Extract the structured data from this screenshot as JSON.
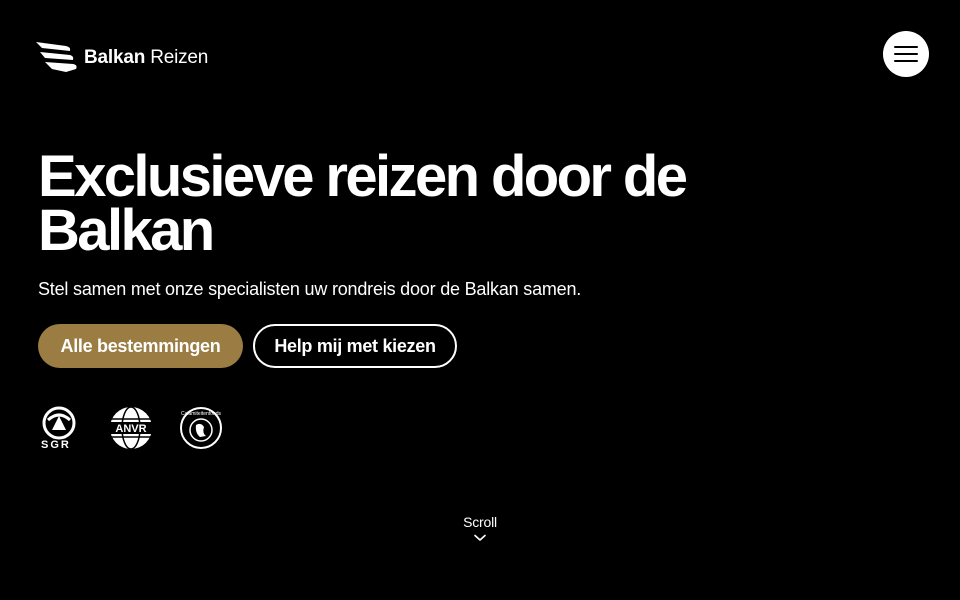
{
  "header": {
    "brand_bold": "Balkan",
    "brand_light": "Reizen",
    "menu_icon": "hamburger-menu-icon"
  },
  "hero": {
    "title": "Exclusieve reizen door de Balkan",
    "subtitle": "Stel samen met onze specialisten uw rondreis door de Balkan samen.",
    "primary_button": "Alle bestemmingen",
    "secondary_button": "Help mij met kiezen"
  },
  "badges": [
    {
      "icon": "sgr-logo-icon",
      "label": "SGR"
    },
    {
      "icon": "anvr-logo-icon",
      "label": "ANVR"
    },
    {
      "icon": "calamiteitenfonds-logo-icon",
      "label": "Calamiteitenfonds"
    }
  ],
  "scroll": {
    "label": "Scroll",
    "icon": "chevron-down-icon"
  },
  "colors": {
    "background": "#000000",
    "accent": "#9b7d43",
    "text": "#ffffff"
  }
}
